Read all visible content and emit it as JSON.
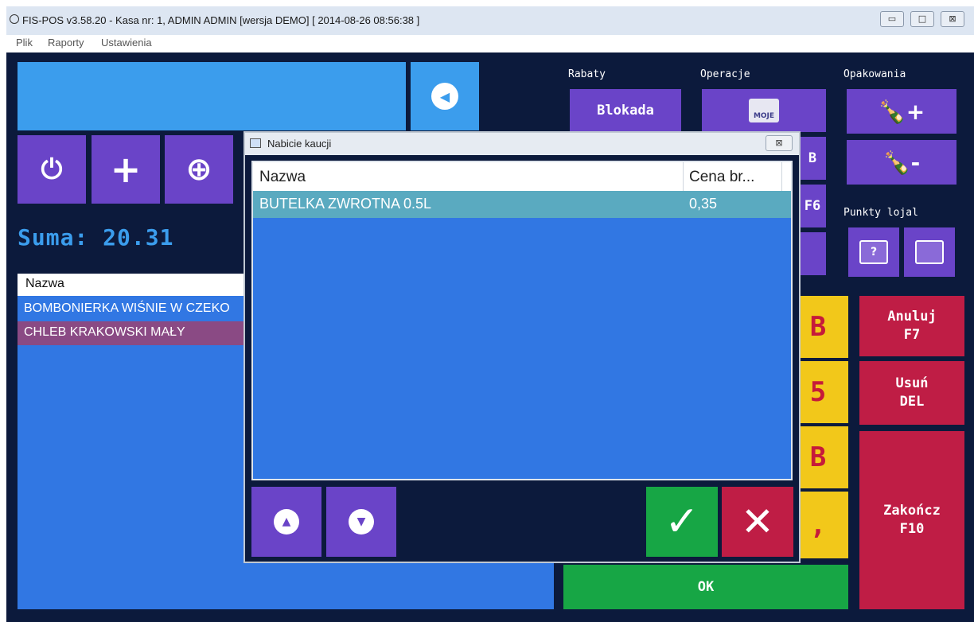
{
  "window": {
    "title": "FIS-POS v3.58.20 - Kasa nr: 1, ADMIN ADMIN [wersja DEMO]  [ 2014-08-26 08:56:38 ]",
    "controls": {
      "minimize": "▭",
      "maximize": "□",
      "close": "⊠"
    }
  },
  "menu": {
    "items": [
      "Plik",
      "Raporty",
      "Ustawienia"
    ]
  },
  "sections": {
    "rabaty": "Rabaty",
    "operacje": "Operacje",
    "opakowania": "Opakowania",
    "punkty": "Punkty lojal"
  },
  "buttons": {
    "blokada": "Blokada",
    "moje": "MOJE",
    "anuluj": "Anuluj\nF7",
    "usun": "Usuń\nDEL",
    "zakoncz": "Zakończ\nF10",
    "ok": "OK",
    "f6_fragment": "F6",
    "b_fragment": "B"
  },
  "icons": {
    "back": "◀",
    "plus": "+",
    "circle_plus": "⊕",
    "power": "⏻",
    "up": "▲",
    "down": "▼",
    "check": "✓",
    "cross": "✕"
  },
  "suma": "Suma: 20.31",
  "left_list": {
    "header": "Nazwa",
    "rows": [
      "BOMBONIERKA WIŚNIE W CZEKO",
      "CHLEB KRAKOWSKI MAŁY"
    ]
  },
  "yellow_fragments": [
    "B",
    "5",
    "B",
    ","
  ],
  "dialog": {
    "title": "Nabicie kaucji",
    "close": "⊠",
    "columns": [
      "Nazwa",
      "Cena br..."
    ],
    "rows": [
      {
        "name": "BUTELKA ZWROTNA 0.5L",
        "price": "0,35"
      }
    ]
  },
  "colors": {
    "background": "#0c1a3c",
    "purple": "#6a44c8",
    "blue": "#3b9ded",
    "list_blue": "#3177e3",
    "yellow": "#f2c81a",
    "red": "#bf1d45",
    "green": "#17a645",
    "selected_row": "#5aaac0"
  }
}
